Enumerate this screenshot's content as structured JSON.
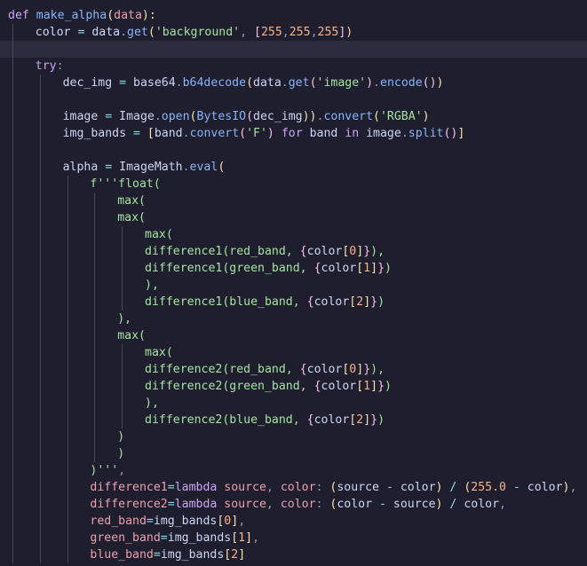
{
  "editor": {
    "language": "python",
    "theme": {
      "background": "#1e1e2e",
      "current_line": "#2a2b3d",
      "indent_guide": "#45475a"
    },
    "lines": [
      {
        "indent": 0,
        "tokens": [
          {
            "t": "def",
            "c": "keyword"
          },
          {
            "t": " ",
            "c": "plain"
          },
          {
            "t": "make_alpha",
            "c": "function"
          },
          {
            "t": "(",
            "c": "bracket"
          },
          {
            "t": "data",
            "c": "param"
          },
          {
            "t": "):",
            "c": "bracket"
          }
        ]
      },
      {
        "indent": 1,
        "tokens": [
          {
            "t": "color",
            "c": "variable"
          },
          {
            "t": " = ",
            "c": "operator"
          },
          {
            "t": "data",
            "c": "variable"
          },
          {
            "t": ".",
            "c": "punct"
          },
          {
            "t": "get",
            "c": "function"
          },
          {
            "t": "(",
            "c": "bracket"
          },
          {
            "t": "'background'",
            "c": "string"
          },
          {
            "t": ", ",
            "c": "punct"
          },
          {
            "t": "[",
            "c": "brace"
          },
          {
            "t": "255",
            "c": "number"
          },
          {
            "t": ",",
            "c": "punct"
          },
          {
            "t": "255",
            "c": "number"
          },
          {
            "t": ",",
            "c": "punct"
          },
          {
            "t": "255",
            "c": "number"
          },
          {
            "t": "]",
            "c": "brace"
          },
          {
            "t": ")",
            "c": "bracket"
          }
        ]
      },
      {
        "indent": 1,
        "current": true,
        "tokens": []
      },
      {
        "indent": 1,
        "tokens": [
          {
            "t": "try",
            "c": "keyword"
          },
          {
            "t": ":",
            "c": "punct"
          }
        ]
      },
      {
        "indent": 2,
        "tokens": [
          {
            "t": "dec_img",
            "c": "variable"
          },
          {
            "t": " = ",
            "c": "operator"
          },
          {
            "t": "base64",
            "c": "variable"
          },
          {
            "t": ".",
            "c": "punct"
          },
          {
            "t": "b64decode",
            "c": "function"
          },
          {
            "t": "(",
            "c": "bracket"
          },
          {
            "t": "data",
            "c": "variable"
          },
          {
            "t": ".",
            "c": "punct"
          },
          {
            "t": "get",
            "c": "function"
          },
          {
            "t": "(",
            "c": "brace"
          },
          {
            "t": "'image'",
            "c": "string"
          },
          {
            "t": ")",
            "c": "brace"
          },
          {
            "t": ".",
            "c": "punct"
          },
          {
            "t": "encode",
            "c": "function"
          },
          {
            "t": "()",
            "c": "brace"
          },
          {
            "t": ")",
            "c": "bracket"
          }
        ]
      },
      {
        "indent": 2,
        "tokens": []
      },
      {
        "indent": 2,
        "tokens": [
          {
            "t": "image",
            "c": "variable"
          },
          {
            "t": " = ",
            "c": "operator"
          },
          {
            "t": "Image",
            "c": "variable"
          },
          {
            "t": ".",
            "c": "punct"
          },
          {
            "t": "open",
            "c": "function"
          },
          {
            "t": "(",
            "c": "bracket"
          },
          {
            "t": "BytesIO",
            "c": "function"
          },
          {
            "t": "(",
            "c": "brace"
          },
          {
            "t": "dec_img",
            "c": "variable"
          },
          {
            "t": "))",
            "c": "bracket"
          },
          {
            "t": ".",
            "c": "punct"
          },
          {
            "t": "convert",
            "c": "function"
          },
          {
            "t": "(",
            "c": "bracket"
          },
          {
            "t": "'RGBA'",
            "c": "string"
          },
          {
            "t": ")",
            "c": "bracket"
          }
        ]
      },
      {
        "indent": 2,
        "tokens": [
          {
            "t": "img_bands",
            "c": "variable"
          },
          {
            "t": " = ",
            "c": "operator"
          },
          {
            "t": "[",
            "c": "bracket"
          },
          {
            "t": "band",
            "c": "variable"
          },
          {
            "t": ".",
            "c": "punct"
          },
          {
            "t": "convert",
            "c": "function"
          },
          {
            "t": "(",
            "c": "brace"
          },
          {
            "t": "'F'",
            "c": "string"
          },
          {
            "t": ")",
            "c": "brace"
          },
          {
            "t": " for ",
            "c": "keyword"
          },
          {
            "t": "band",
            "c": "variable"
          },
          {
            "t": " in ",
            "c": "keyword"
          },
          {
            "t": "image",
            "c": "variable"
          },
          {
            "t": ".",
            "c": "punct"
          },
          {
            "t": "split",
            "c": "function"
          },
          {
            "t": "()",
            "c": "brace"
          },
          {
            "t": "]",
            "c": "bracket"
          }
        ]
      },
      {
        "indent": 2,
        "tokens": []
      },
      {
        "indent": 2,
        "tokens": [
          {
            "t": "alpha",
            "c": "variable"
          },
          {
            "t": " = ",
            "c": "operator"
          },
          {
            "t": "ImageMath",
            "c": "variable"
          },
          {
            "t": ".",
            "c": "punct"
          },
          {
            "t": "eval",
            "c": "function"
          },
          {
            "t": "(",
            "c": "bracket"
          }
        ]
      },
      {
        "indent": 3,
        "tokens": [
          {
            "t": "f'''float(",
            "c": "string"
          }
        ]
      },
      {
        "indent": 4,
        "tokens": [
          {
            "t": "max(",
            "c": "string"
          }
        ]
      },
      {
        "indent": 4,
        "tokens": [
          {
            "t": "max(",
            "c": "string"
          }
        ]
      },
      {
        "indent": 5,
        "tokens": [
          {
            "t": "max(",
            "c": "string"
          }
        ]
      },
      {
        "indent": 5,
        "tokens": [
          {
            "t": "difference1(red_band, ",
            "c": "string"
          },
          {
            "t": "{",
            "c": "brace"
          },
          {
            "t": "color",
            "c": "variable"
          },
          {
            "t": "[",
            "c": "bracket"
          },
          {
            "t": "0",
            "c": "number"
          },
          {
            "t": "]",
            "c": "bracket"
          },
          {
            "t": "}",
            "c": "brace"
          },
          {
            "t": "),",
            "c": "string"
          }
        ]
      },
      {
        "indent": 5,
        "tokens": [
          {
            "t": "difference1(green_band, ",
            "c": "string"
          },
          {
            "t": "{",
            "c": "brace"
          },
          {
            "t": "color",
            "c": "variable"
          },
          {
            "t": "[",
            "c": "bracket"
          },
          {
            "t": "1",
            "c": "number"
          },
          {
            "t": "]",
            "c": "bracket"
          },
          {
            "t": "}",
            "c": "brace"
          },
          {
            "t": ")",
            "c": "string"
          }
        ]
      },
      {
        "indent": 5,
        "tokens": [
          {
            "t": "),",
            "c": "string"
          }
        ]
      },
      {
        "indent": 5,
        "tokens": [
          {
            "t": "difference1(blue_band, ",
            "c": "string"
          },
          {
            "t": "{",
            "c": "brace"
          },
          {
            "t": "color",
            "c": "variable"
          },
          {
            "t": "[",
            "c": "bracket"
          },
          {
            "t": "2",
            "c": "number"
          },
          {
            "t": "]",
            "c": "bracket"
          },
          {
            "t": "}",
            "c": "brace"
          },
          {
            "t": ")",
            "c": "string"
          }
        ]
      },
      {
        "indent": 4,
        "tokens": [
          {
            "t": "),",
            "c": "string"
          }
        ]
      },
      {
        "indent": 4,
        "tokens": [
          {
            "t": "max(",
            "c": "string"
          }
        ]
      },
      {
        "indent": 5,
        "tokens": [
          {
            "t": "max(",
            "c": "string"
          }
        ]
      },
      {
        "indent": 5,
        "tokens": [
          {
            "t": "difference2(red_band, ",
            "c": "string"
          },
          {
            "t": "{",
            "c": "brace"
          },
          {
            "t": "color",
            "c": "variable"
          },
          {
            "t": "[",
            "c": "bracket"
          },
          {
            "t": "0",
            "c": "number"
          },
          {
            "t": "]",
            "c": "bracket"
          },
          {
            "t": "}",
            "c": "brace"
          },
          {
            "t": "),",
            "c": "string"
          }
        ]
      },
      {
        "indent": 5,
        "tokens": [
          {
            "t": "difference2(green_band, ",
            "c": "string"
          },
          {
            "t": "{",
            "c": "brace"
          },
          {
            "t": "color",
            "c": "variable"
          },
          {
            "t": "[",
            "c": "bracket"
          },
          {
            "t": "1",
            "c": "number"
          },
          {
            "t": "]",
            "c": "bracket"
          },
          {
            "t": "}",
            "c": "brace"
          },
          {
            "t": ")",
            "c": "string"
          }
        ]
      },
      {
        "indent": 5,
        "tokens": [
          {
            "t": "),",
            "c": "string"
          }
        ]
      },
      {
        "indent": 5,
        "tokens": [
          {
            "t": "difference2(blue_band, ",
            "c": "string"
          },
          {
            "t": "{",
            "c": "brace"
          },
          {
            "t": "color",
            "c": "variable"
          },
          {
            "t": "[",
            "c": "bracket"
          },
          {
            "t": "2",
            "c": "number"
          },
          {
            "t": "]",
            "c": "bracket"
          },
          {
            "t": "}",
            "c": "brace"
          },
          {
            "t": ")",
            "c": "string"
          }
        ]
      },
      {
        "indent": 4,
        "tokens": [
          {
            "t": ")",
            "c": "string"
          }
        ]
      },
      {
        "indent": 4,
        "tokens": [
          {
            "t": ")",
            "c": "string"
          }
        ]
      },
      {
        "indent": 3,
        "tokens": [
          {
            "t": ")'''",
            "c": "string"
          },
          {
            "t": ",",
            "c": "punct"
          }
        ]
      },
      {
        "indent": 3,
        "tokens": [
          {
            "t": "difference1",
            "c": "param"
          },
          {
            "t": "=",
            "c": "operator"
          },
          {
            "t": "lambda",
            "c": "keyword"
          },
          {
            "t": " ",
            "c": "plain"
          },
          {
            "t": "source",
            "c": "param"
          },
          {
            "t": ", ",
            "c": "punct"
          },
          {
            "t": "color",
            "c": "param"
          },
          {
            "t": ": ",
            "c": "punct"
          },
          {
            "t": "(",
            "c": "bracket"
          },
          {
            "t": "source",
            "c": "variable"
          },
          {
            "t": " - ",
            "c": "operator"
          },
          {
            "t": "color",
            "c": "variable"
          },
          {
            "t": ")",
            "c": "bracket"
          },
          {
            "t": " / ",
            "c": "operator"
          },
          {
            "t": "(",
            "c": "bracket"
          },
          {
            "t": "255.0",
            "c": "number"
          },
          {
            "t": " - ",
            "c": "operator"
          },
          {
            "t": "color",
            "c": "variable"
          },
          {
            "t": ")",
            "c": "bracket"
          },
          {
            "t": ",",
            "c": "punct"
          }
        ]
      },
      {
        "indent": 3,
        "tokens": [
          {
            "t": "difference2",
            "c": "param"
          },
          {
            "t": "=",
            "c": "operator"
          },
          {
            "t": "lambda",
            "c": "keyword"
          },
          {
            "t": " ",
            "c": "plain"
          },
          {
            "t": "source",
            "c": "param"
          },
          {
            "t": ", ",
            "c": "punct"
          },
          {
            "t": "color",
            "c": "param"
          },
          {
            "t": ": ",
            "c": "punct"
          },
          {
            "t": "(",
            "c": "bracket"
          },
          {
            "t": "color",
            "c": "variable"
          },
          {
            "t": " - ",
            "c": "operator"
          },
          {
            "t": "source",
            "c": "variable"
          },
          {
            "t": ")",
            "c": "bracket"
          },
          {
            "t": " / ",
            "c": "operator"
          },
          {
            "t": "color",
            "c": "variable"
          },
          {
            "t": ",",
            "c": "punct"
          }
        ]
      },
      {
        "indent": 3,
        "tokens": [
          {
            "t": "red_band",
            "c": "param"
          },
          {
            "t": "=",
            "c": "operator"
          },
          {
            "t": "img_bands",
            "c": "variable"
          },
          {
            "t": "[",
            "c": "bracket"
          },
          {
            "t": "0",
            "c": "number"
          },
          {
            "t": "]",
            "c": "bracket"
          },
          {
            "t": ",",
            "c": "punct"
          }
        ]
      },
      {
        "indent": 3,
        "tokens": [
          {
            "t": "green_band",
            "c": "param"
          },
          {
            "t": "=",
            "c": "operator"
          },
          {
            "t": "img_bands",
            "c": "variable"
          },
          {
            "t": "[",
            "c": "bracket"
          },
          {
            "t": "1",
            "c": "number"
          },
          {
            "t": "]",
            "c": "bracket"
          },
          {
            "t": ",",
            "c": "punct"
          }
        ]
      },
      {
        "indent": 3,
        "tokens": [
          {
            "t": "blue_band",
            "c": "param"
          },
          {
            "t": "=",
            "c": "operator"
          },
          {
            "t": "img_bands",
            "c": "variable"
          },
          {
            "t": "[",
            "c": "bracket"
          },
          {
            "t": "2",
            "c": "number"
          },
          {
            "t": "]",
            "c": "bracket"
          }
        ]
      }
    ]
  }
}
